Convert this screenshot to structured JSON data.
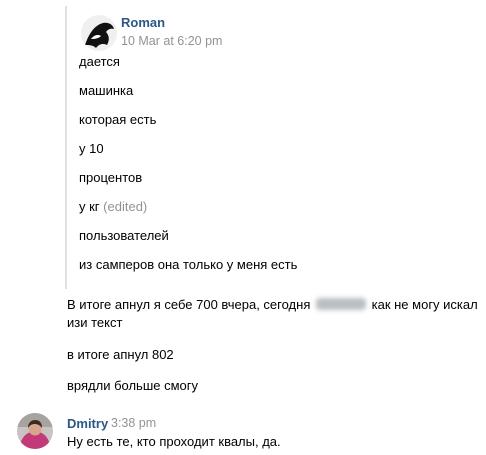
{
  "quoted": {
    "author": "Roman",
    "time": "10 Mar at 6:20 pm",
    "lines": [
      "дается",
      "машинка",
      "которая есть",
      "у 10",
      "процентов",
      "у кг",
      "пользователей",
      "из самперов она только у меня есть"
    ],
    "edited_label": "(edited)"
  },
  "messages": {
    "m1_before": "В итоге апнул я себе 700 вчера, сегодня",
    "m1_after": "как не могу искал",
    "m1_line2": "изи текст",
    "m2": "в итоге апнул 802",
    "m3": "врядли больше смогу"
  },
  "dmitry": {
    "author": "Dmitry",
    "time": "3:38 pm",
    "text": "Ну есть те, кто проходит квалы, да."
  },
  "colors": {
    "author": "#2a5885",
    "meta": "#939393",
    "quote_bar": "#dce1e6"
  }
}
